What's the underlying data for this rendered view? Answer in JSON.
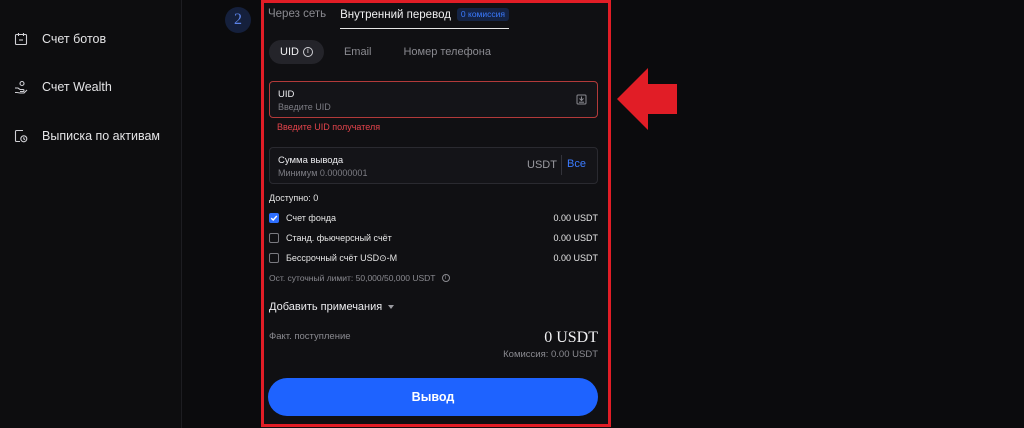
{
  "sidebar": {
    "items": [
      {
        "label": "Счет ботов",
        "icon": "calendar-bot-icon"
      },
      {
        "label": "Счет Wealth",
        "icon": "hand-coins-icon"
      },
      {
        "label": "Выписка по активам",
        "icon": "statement-clock-icon"
      }
    ]
  },
  "step": {
    "number": "2"
  },
  "transfer_tabs": {
    "network": "Через сеть",
    "internal": "Внутренний перевод",
    "internal_badge": "0 комиссия"
  },
  "recipient_tabs": {
    "uid": "UID",
    "email": "Email",
    "phone": "Номер телефона"
  },
  "uid_field": {
    "label": "UID",
    "placeholder": "Введите UID",
    "value": "",
    "error": "Введите UID получателя"
  },
  "amount_field": {
    "label": "Сумма вывода",
    "placeholder": "Минимум 0.00000001",
    "value": "",
    "unit": "USDT",
    "all_label": "Все"
  },
  "available": {
    "text": "Доступно:  0"
  },
  "accounts": [
    {
      "name": "Счет фонда",
      "amount": "0.00 USDT",
      "checked": true
    },
    {
      "name": "Станд. фьючерсный счёт",
      "amount": "0.00 USDT",
      "checked": false
    },
    {
      "name": "Бессрочный счёт USD⊙-M",
      "amount": "0.00 USDT",
      "checked": false
    }
  ],
  "daily_limit": {
    "text": "Ост. суточный лимит:  50,000/50,000 USDT"
  },
  "notes": {
    "label": "Добавить примечания"
  },
  "receipt": {
    "label": "Факт. поступление",
    "value": "0 USDT",
    "fee": "Комиссия:  0.00 USDT"
  },
  "submit": {
    "label": "Вывод"
  },
  "colors": {
    "accent": "#1e63ff",
    "error": "#e2434b",
    "highlight": "#e11d26"
  }
}
